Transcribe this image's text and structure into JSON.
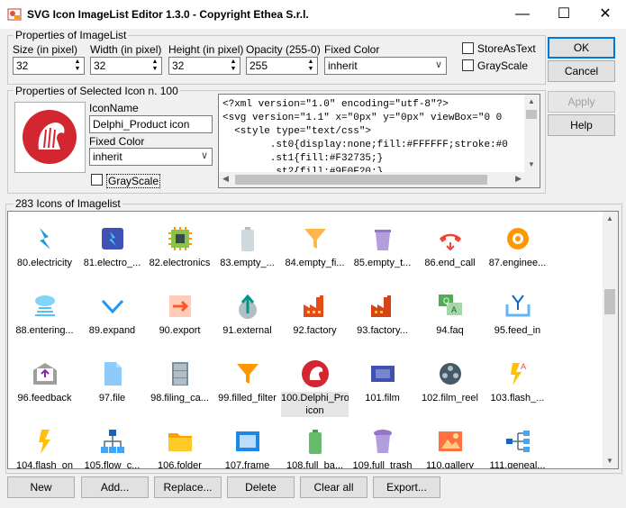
{
  "window": {
    "title": "SVG Icon ImageList Editor 1.3.0 - Copyright Ethea S.r.l."
  },
  "imagelist": {
    "group_label": "Properties of ImageList",
    "size_label": "Size (in pixel)",
    "size_value": "32",
    "width_label": "Width (in pixel)",
    "width_value": "32",
    "height_label": "Height (in pixel)",
    "height_value": "32",
    "opacity_label": "Opacity (255-0)",
    "opacity_value": "255",
    "fixed_color_label": "Fixed Color",
    "fixed_color_value": "inherit",
    "store_as_text_label": "StoreAsText",
    "grayscale_label": "GrayScale"
  },
  "buttons": {
    "ok": "OK",
    "cancel": "Cancel",
    "apply": "Apply",
    "help": "Help"
  },
  "selected": {
    "group_label": "Properties of Selected Icon n. 100",
    "iconname_label": "IconName",
    "iconname_value": "Delphi_Product icon",
    "fixed_color_label": "Fixed Color",
    "fixed_color_value": "inherit",
    "grayscale_label": "GrayScale",
    "svg_lines": [
      "<?xml version=\"1.0\" encoding=\"utf-8\"?>",
      "<svg version=\"1.1\" x=\"0px\" y=\"0px\" viewBox=\"0 0",
      "  <style type=\"text/css\">",
      "        .st0{display:none;fill:#FFFFFF;stroke:#0",
      "        .st1{fill:#F32735;}",
      "        .st2{fill:#9E0F20;}"
    ]
  },
  "list": {
    "group_label": "283 Icons of Imagelist",
    "items": [
      "80.electricity",
      "81.electro_...",
      "82.electronics",
      "83.empty_...",
      "84.empty_fi...",
      "85.empty_t...",
      "86.end_call",
      "87.enginee...",
      "88.entering...",
      "89.expand",
      "90.export",
      "91.external",
      "92.factory",
      "93.factory...",
      "94.faq",
      "95.feed_in",
      "96.feedback",
      "97.file",
      "98.filing_ca...",
      "99.filled_filter",
      "100.Delphi_Product icon",
      "101.film",
      "102.film_reel",
      "103.flash_...",
      "104.flash_on",
      "105.flow_c...",
      "106.folder",
      "107.frame",
      "108.full_ba...",
      "109.full_trash",
      "110.gallery",
      "111.geneal..."
    ]
  },
  "bottom": {
    "new": "New",
    "add": "Add...",
    "replace": "Replace...",
    "delete": "Delete",
    "clear_all": "Clear all",
    "export": "Export..."
  }
}
